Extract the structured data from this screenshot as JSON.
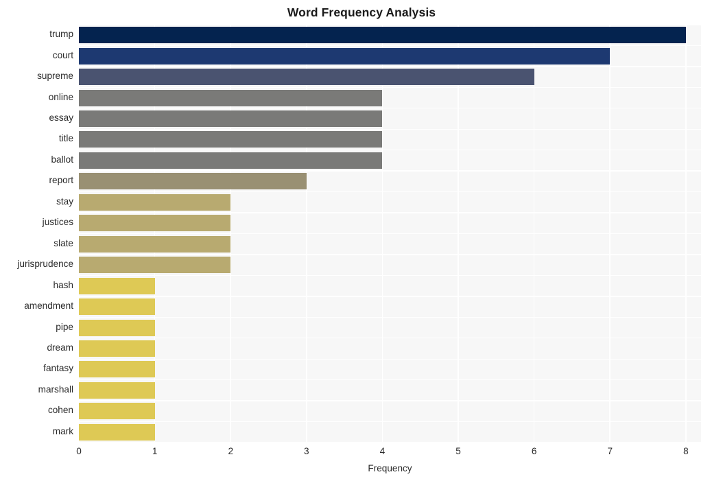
{
  "chart_data": {
    "type": "bar",
    "orientation": "horizontal",
    "title": "Word Frequency Analysis",
    "xlabel": "Frequency",
    "ylabel": "",
    "xlim": [
      0,
      8.2
    ],
    "xticks": [
      0,
      1,
      2,
      3,
      4,
      5,
      6,
      7,
      8
    ],
    "xtick_labels": [
      "0",
      "1",
      "2",
      "3",
      "4",
      "5",
      "6",
      "7",
      "8"
    ],
    "grid": true,
    "legend": "none",
    "categories": [
      "trump",
      "court",
      "supreme",
      "online",
      "essay",
      "title",
      "ballot",
      "report",
      "stay",
      "justices",
      "slate",
      "jurisprudence",
      "hash",
      "amendment",
      "pipe",
      "dream",
      "fantasy",
      "marshall",
      "cohen",
      "mark"
    ],
    "values": [
      8,
      7,
      6,
      4,
      4,
      4,
      4,
      3,
      2,
      2,
      2,
      2,
      1,
      1,
      1,
      1,
      1,
      1,
      1,
      1
    ],
    "bar_colors": [
      "#04234f",
      "#1d3971",
      "#4a5370",
      "#7a7a78",
      "#7a7a78",
      "#7a7a78",
      "#7a7a78",
      "#999073",
      "#b8aa70",
      "#b8aa70",
      "#b8aa70",
      "#b8aa70",
      "#dec955",
      "#dec955",
      "#dec955",
      "#dec955",
      "#dec955",
      "#dec955",
      "#dec955",
      "#dec955"
    ]
  },
  "style": {
    "plot_background": "#f7f7f7",
    "figure_background": "#ffffff",
    "gridline_color": "#ffffff",
    "text_color": "#2a2a2a",
    "title_color": "#1a1a1a"
  }
}
